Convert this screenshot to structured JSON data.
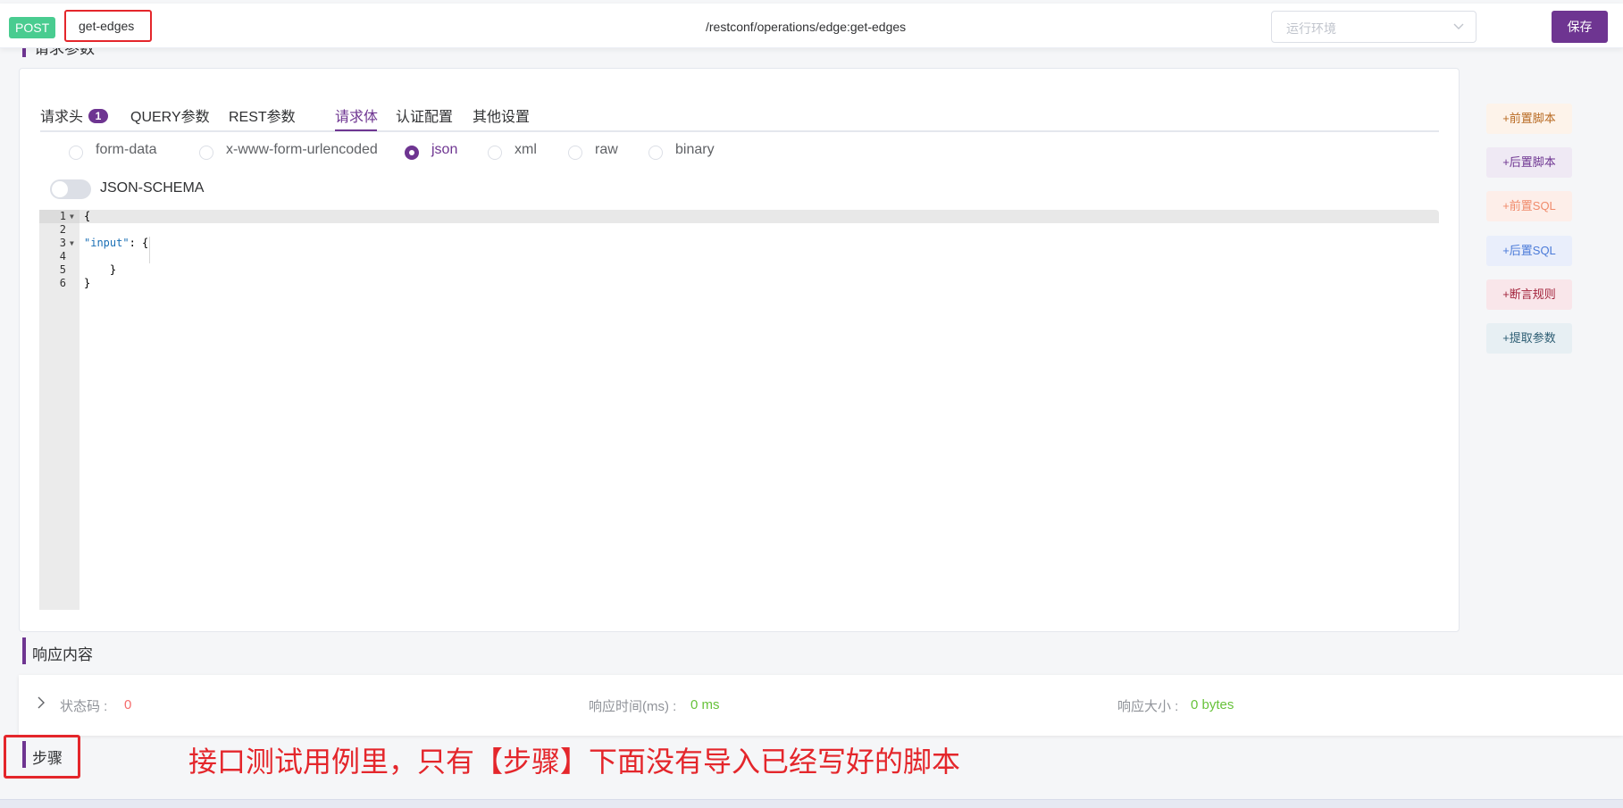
{
  "header": {
    "method": "POST",
    "api_name": "get-edges",
    "path": "/restconf/operations/edge:get-edges",
    "env_placeholder": "运行环境",
    "save_label": "保存"
  },
  "request": {
    "section_title": "请求参数",
    "tabs": [
      {
        "label": "请求头",
        "badge": "1"
      },
      {
        "label": "QUERY参数"
      },
      {
        "label": "REST参数"
      },
      {
        "label": "请求体",
        "active": true
      },
      {
        "label": "认证配置"
      },
      {
        "label": "其他设置"
      }
    ],
    "body_types": [
      "form-data",
      "x-www-form-urlencoded",
      "json",
      "xml",
      "raw",
      "binary"
    ],
    "selected_body_type": "json",
    "schema_toggle_label": "JSON-SCHEMA",
    "code_lines": [
      {
        "n": "1",
        "text": "{"
      },
      {
        "n": "2",
        "text": ""
      },
      {
        "n": "3",
        "key": "\"input\"",
        "text": ": {"
      },
      {
        "n": "4",
        "text": ""
      },
      {
        "n": "5",
        "text": "    }"
      },
      {
        "n": "6",
        "text": "}"
      }
    ]
  },
  "side_buttons": [
    {
      "label": "+前置脚本",
      "bg": "#fdf3ea",
      "fg": "#b86a22"
    },
    {
      "label": "+后置脚本",
      "bg": "#efe9f4",
      "fg": "#6e3591"
    },
    {
      "label": "+前置SQL",
      "bg": "#fdeee9",
      "fg": "#f08a6a"
    },
    {
      "label": "+后置SQL",
      "bg": "#e9eefb",
      "fg": "#4a7ad8"
    },
    {
      "label": "+断言规则",
      "bg": "#f9e6ea",
      "fg": "#a3253d"
    },
    {
      "label": "+提取参数",
      "bg": "#e7eff3",
      "fg": "#2d5d73"
    }
  ],
  "response": {
    "title": "响应内容",
    "status_label": "状态码 :",
    "status_value": "0",
    "time_label": "响应时间(ms) :",
    "time_value": "0 ms",
    "size_label": "响应大小 :",
    "size_value": "0 bytes"
  },
  "steps": {
    "title": "步骤"
  },
  "annotation": "接口测试用例里，只有【步骤】下面没有导入已经写好的脚本"
}
